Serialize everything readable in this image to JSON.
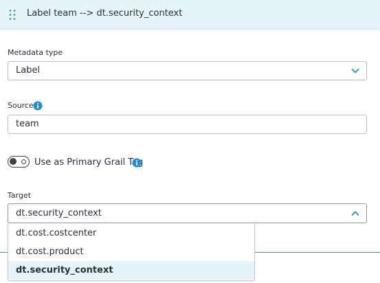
{
  "header": {
    "title": "Label team --> dt.security_context"
  },
  "metadata_type": {
    "label": "Metadata type",
    "value": "Label"
  },
  "source": {
    "label": "Source",
    "value": "team"
  },
  "primary_tag": {
    "label": "Use as Primary Grail Tag",
    "enabled": false
  },
  "target": {
    "label": "Target",
    "value": "dt.security_context",
    "options": [
      {
        "label": "dt.cost.costcenter"
      },
      {
        "label": "dt.cost.product"
      },
      {
        "label": "dt.security_context",
        "selected": true
      }
    ]
  },
  "colors": {
    "header_bg": "#e5f4f7",
    "accent": "#2aa3b5",
    "info_icon": "#1e8fd6",
    "text": "#2b2f3a",
    "border": "#b7bcc7"
  }
}
